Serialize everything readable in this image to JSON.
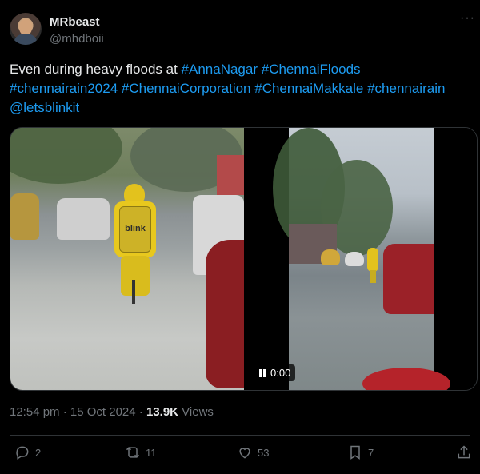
{
  "author": {
    "name": "MRbeast",
    "handle": "@mhdboii"
  },
  "tweet": {
    "segments": [
      {
        "t": "Even during heavy floods at ",
        "tag": false
      },
      {
        "t": "#AnnaNagar",
        "tag": true
      },
      {
        "t": " ",
        "tag": false
      },
      {
        "t": "#ChennaiFloods",
        "tag": true
      },
      {
        "t": " ",
        "tag": false
      },
      {
        "t": "#chennairain2024",
        "tag": true
      },
      {
        "t": " ",
        "tag": false
      },
      {
        "t": "#ChennaiCorporation",
        "tag": true
      },
      {
        "t": " ",
        "tag": false
      },
      {
        "t": "#ChennaiMakkale",
        "tag": true
      },
      {
        "t": " ",
        "tag": false
      },
      {
        "t": "#chennairain",
        "tag": true
      },
      {
        "t": " ",
        "tag": false
      },
      {
        "t": "@letsblinkit",
        "tag": true
      }
    ]
  },
  "media": {
    "video_time": "0:00",
    "bag_text": "blink"
  },
  "meta": {
    "time": "12:54 pm",
    "separator": "·",
    "date": "15 Oct 2024",
    "views_count": "13.9K",
    "views_label": "Views"
  },
  "actions": {
    "replies": "2",
    "reposts": "11",
    "likes": "53",
    "bookmarks": "7"
  },
  "colors": {
    "background": "#000000",
    "text": "#e7e9ea",
    "muted": "#71767b",
    "link": "#1d9bf0",
    "border": "#2f3336"
  }
}
